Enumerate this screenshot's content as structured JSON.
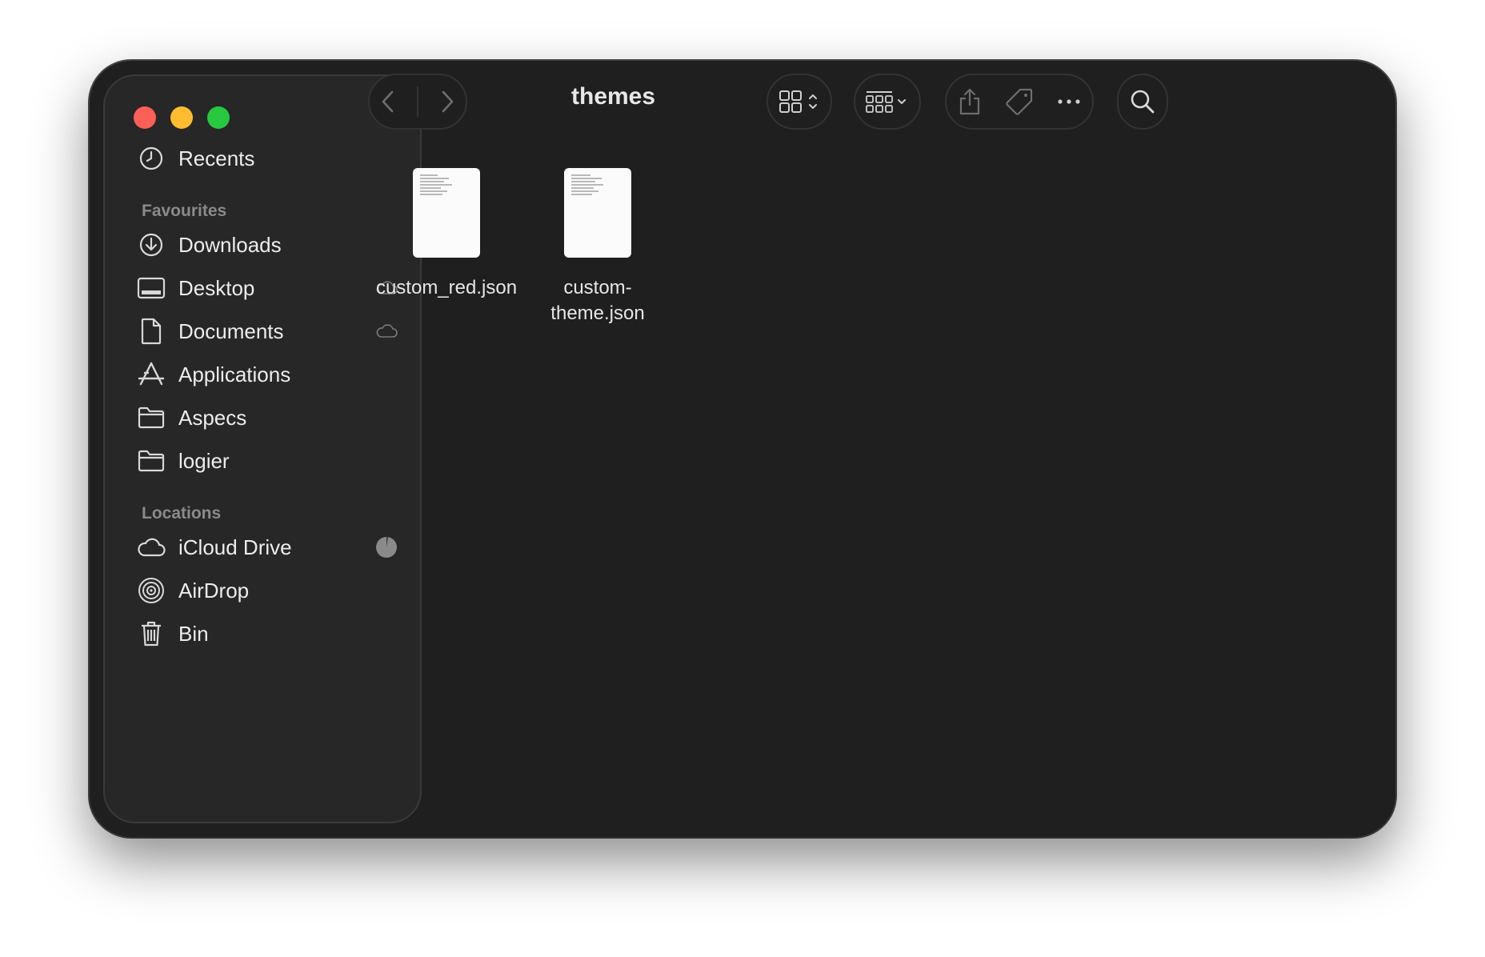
{
  "window": {
    "title": "themes"
  },
  "sidebar": {
    "top_item": {
      "label": "Recents",
      "icon": "clock-icon"
    },
    "sections": [
      {
        "heading": "Favourites",
        "items": [
          {
            "label": "Downloads",
            "icon": "download-icon"
          },
          {
            "label": "Desktop",
            "icon": "desktop-icon",
            "trail": "icloud-icon"
          },
          {
            "label": "Documents",
            "icon": "document-icon",
            "trail": "icloud-icon"
          },
          {
            "label": "Applications",
            "icon": "applications-icon"
          },
          {
            "label": "Aspecs",
            "icon": "folder-icon"
          },
          {
            "label": "logier",
            "icon": "folder-icon"
          }
        ]
      },
      {
        "heading": "Locations",
        "items": [
          {
            "label": "iCloud Drive",
            "icon": "cloud-icon",
            "trail": "storage-pie-icon"
          },
          {
            "label": "AirDrop",
            "icon": "airdrop-icon"
          },
          {
            "label": "Bin",
            "icon": "trash-icon"
          }
        ]
      }
    ]
  },
  "files": [
    {
      "name": "custom_red.json",
      "icon": "json-document-icon"
    },
    {
      "name": "custom-\ntheme.json",
      "icon": "json-document-icon"
    }
  ],
  "colors": {
    "close": "#fe5f57",
    "minimize": "#febc2e",
    "maximize": "#28c840",
    "window_bg": "#1f1f1f",
    "sidebar_bg": "#272727"
  }
}
